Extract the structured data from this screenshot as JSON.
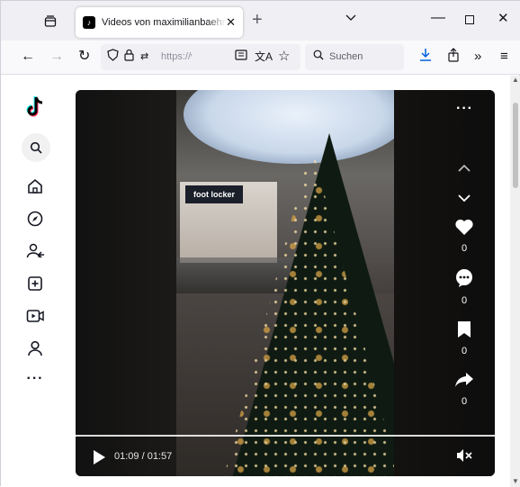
{
  "browser": {
    "tab_title": "Videos von maximilianbaehring",
    "url_text": "https://w",
    "search_placeholder": "Suchen",
    "icons": [
      "tab-list-icon",
      "tiktok-favicon",
      "close-icon",
      "plus-icon",
      "chevron-down-icon",
      "minimize-icon",
      "maximize-icon",
      "window-close-icon",
      "back-arrow-icon",
      "forward-arrow-icon",
      "reload-icon",
      "shield-icon",
      "lock-icon",
      "permissions-icon",
      "reader-view-icon",
      "translate-icon",
      "bookmark-star-icon",
      "search-icon",
      "download-icon",
      "share-icon",
      "overflow-chevrons-icon",
      "hamburger-menu-icon"
    ]
  },
  "sidebar": {
    "items": [
      "tiktok-logo",
      "search-icon",
      "home-icon",
      "explore-icon",
      "following-icon",
      "upload-icon",
      "live-icon",
      "profile-icon",
      "more-icon"
    ]
  },
  "video": {
    "store_sign": "foot locker",
    "time_display": "01:09 / 01:57",
    "progress": 0.59,
    "like_count": "0",
    "comment_count": "0",
    "bookmark_count": "0",
    "share_count": "0"
  },
  "colors": {
    "tab_strip_bg": "#f0f0f4",
    "toolbar_bg": "#f9f9fb",
    "video_bg": "#0b0b0b",
    "download_accent": "#0061e0"
  }
}
